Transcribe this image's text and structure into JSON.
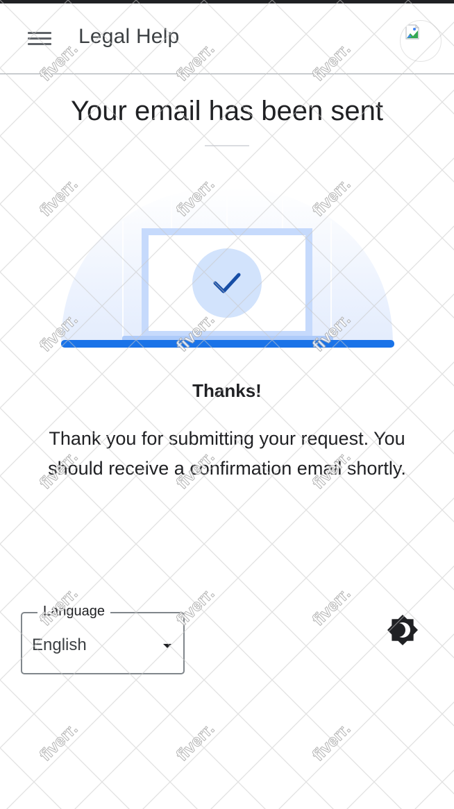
{
  "header": {
    "title": "Legal Help",
    "menu_icon": "hamburger-menu-icon",
    "avatar_icon": "broken-image-icon"
  },
  "main": {
    "title": "Your email has been sent",
    "illustration_icon": "laptop-checkmark-illustration",
    "thanks_heading": "Thanks!",
    "message": "Thank you for submitting your request. You should receive a confirmation email shortly."
  },
  "footer": {
    "language_label": "Language",
    "language_value": "English",
    "theme_icon": "brightness-toggle-icon"
  },
  "watermark": {
    "text": "fiverr."
  },
  "colors": {
    "accent_blue": "#1a73e8",
    "light_blue": "#aecbfa",
    "pale_blue": "#e8f0fe",
    "check_blue": "#174ea6",
    "text": "#202124"
  }
}
